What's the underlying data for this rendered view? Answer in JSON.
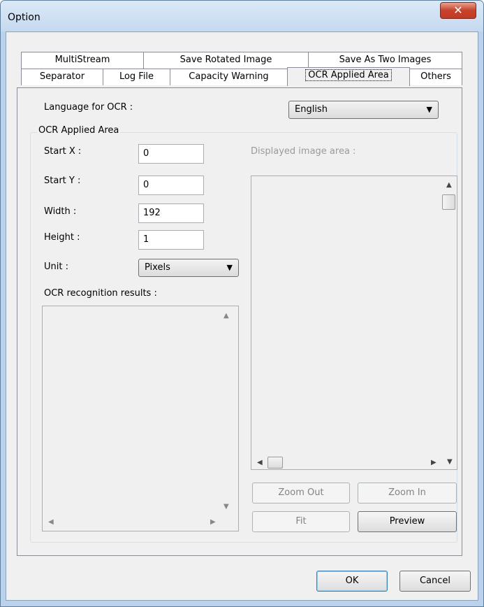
{
  "window": {
    "title": "Option",
    "close_glyph": "✕"
  },
  "tabs_row1": [
    {
      "label": "MultiStream"
    },
    {
      "label": "Save Rotated Image"
    },
    {
      "label": "Save As Two Images"
    }
  ],
  "tabs_row2": [
    {
      "label": "Separator"
    },
    {
      "label": "Log File"
    },
    {
      "label": "Capacity Warning"
    },
    {
      "label": "OCR Applied Area",
      "active": true
    },
    {
      "label": "Others"
    }
  ],
  "language": {
    "label": "Language for OCR :",
    "value": "English"
  },
  "area_group": {
    "title": "OCR Applied Area",
    "start_x": {
      "label": "Start X :",
      "value": "0"
    },
    "start_y": {
      "label": "Start Y :",
      "value": "0"
    },
    "width": {
      "label": "Width :",
      "value": "192"
    },
    "height": {
      "label": "Height :",
      "value": "1"
    },
    "unit": {
      "label": "Unit :",
      "value": "Pixels"
    },
    "results_label": "OCR recognition results :",
    "displayed_label": "Displayed image area :"
  },
  "buttons": {
    "zoom_out": "Zoom Out",
    "zoom_in": "Zoom In",
    "fit": "Fit",
    "preview": "Preview",
    "ok": "OK",
    "cancel": "Cancel"
  },
  "icons": {
    "dropdown": "▼",
    "scroll_up": "▲",
    "scroll_down": "▼",
    "scroll_left": "◀",
    "scroll_right": "▶"
  },
  "colors": {
    "title_bar": "#c5d9ef",
    "close_button": "#c6412b",
    "default_button_border": "#3c7fb1"
  }
}
